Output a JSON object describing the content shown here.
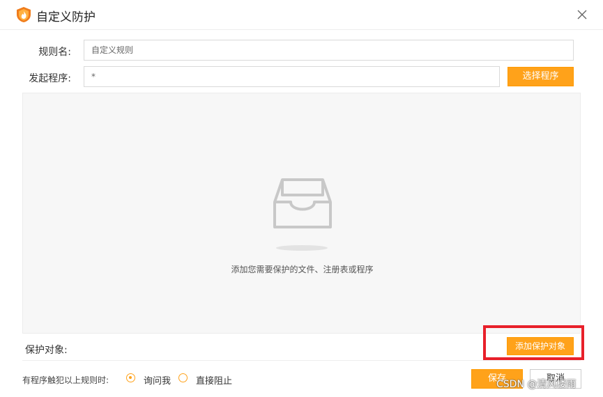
{
  "window": {
    "title": "自定义防护",
    "close_icon": "close-icon"
  },
  "form": {
    "rule_name_label": "规则名:",
    "rule_name_value": "自定义规则",
    "initiator_label": "发起程序:",
    "initiator_value": "*",
    "select_program_button": "选择程序"
  },
  "protected_area": {
    "empty_icon": "empty-inbox-icon",
    "empty_hint": "添加您需要保护的文件、注册表或程序",
    "label": "保护对象:",
    "add_button": "添加保护对象"
  },
  "footer": {
    "trigger_label": "有程序触犯以上规则时:",
    "options": [
      {
        "label": "询问我",
        "selected": true
      },
      {
        "label": "直接阻止",
        "selected": false
      }
    ],
    "save_button": "保存",
    "cancel_button": "取消"
  },
  "watermark": "CSDN @清风楼雨",
  "colors": {
    "accent": "#ffa21a",
    "highlight": "#e8202a"
  }
}
